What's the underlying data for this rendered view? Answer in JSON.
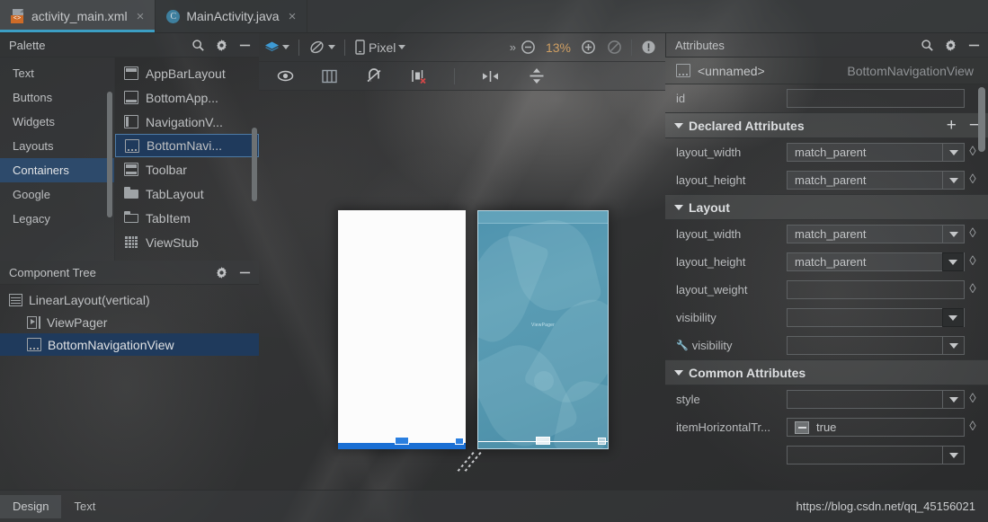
{
  "tabs": [
    {
      "label": "activity_main.xml",
      "icon": "xml-file-icon",
      "active": true,
      "close": "×"
    },
    {
      "label": "MainActivity.java",
      "icon": "java-class-icon",
      "active": false,
      "close": "×"
    }
  ],
  "palette": {
    "title": "Palette",
    "icons": {
      "search": "search-icon",
      "gear": "gear-icon",
      "minimize": "minimize-icon"
    },
    "categories": [
      {
        "label": "Text",
        "selected": false
      },
      {
        "label": "Buttons",
        "selected": false
      },
      {
        "label": "Widgets",
        "selected": false
      },
      {
        "label": "Layouts",
        "selected": false
      },
      {
        "label": "Containers",
        "selected": true
      },
      {
        "label": "Google",
        "selected": false
      },
      {
        "label": "Legacy",
        "selected": false
      }
    ],
    "items": [
      {
        "label": "AppBarLayout",
        "icon": "appbar-icon",
        "selected": false
      },
      {
        "label": "BottomApp...",
        "icon": "bottomappbar-icon",
        "selected": false
      },
      {
        "label": "NavigationV...",
        "icon": "navigationview-icon",
        "selected": false
      },
      {
        "label": "BottomNavi...",
        "icon": "bottomnavigation-icon",
        "selected": true
      },
      {
        "label": "Toolbar",
        "icon": "toolbar-icon",
        "selected": false
      },
      {
        "label": "TabLayout",
        "icon": "tablayout-icon",
        "selected": false
      },
      {
        "label": "TabItem",
        "icon": "tabitem-icon",
        "selected": false
      },
      {
        "label": "ViewStub",
        "icon": "viewstub-icon",
        "selected": false
      }
    ]
  },
  "component_tree": {
    "title": "Component Tree",
    "icons": {
      "gear": "gear-icon",
      "minimize": "minimize-icon"
    },
    "nodes": [
      {
        "label": "LinearLayout(vertical)",
        "depth": 0,
        "icon": "linearlayout-icon",
        "selected": false
      },
      {
        "label": "ViewPager",
        "depth": 1,
        "icon": "viewpager-icon",
        "selected": false
      },
      {
        "label": "BottomNavigationView",
        "depth": 1,
        "icon": "bottomnavigation-icon",
        "selected": true
      }
    ]
  },
  "editor": {
    "toolbar": {
      "design_mode_icon": "layers-icon",
      "orientation_icon": "rotate-icon",
      "device_icon": "phone-icon",
      "device_name": "Pixel",
      "overflow": "»",
      "zoom_out_icon": "zoom-out-icon",
      "zoom_level": "13%",
      "zoom_in_icon": "zoom-in-icon",
      "zoom_fit_icon": "zoom-fit-icon",
      "warnings_icon": "warning-icon"
    },
    "toolbar2": {
      "buttons": [
        {
          "name": "show-constraints-icon",
          "label": "eye"
        },
        {
          "name": "guidelines-icon",
          "label": "columns"
        },
        {
          "name": "autoconnect-off-icon",
          "label": "magnet-off"
        },
        {
          "name": "clear-constraints-icon",
          "label": "clear"
        },
        {
          "name": "align-horizontal-icon",
          "label": "pack-horizontal"
        },
        {
          "name": "align-vertical-icon",
          "label": "pack-vertical"
        }
      ]
    },
    "blueprint_label": "ViewPager"
  },
  "attributes": {
    "title": "Attributes",
    "icons": {
      "search": "search-icon",
      "gear": "gear-icon",
      "minimize": "minimize-icon"
    },
    "selected_name": "<unnamed>",
    "selected_class": "BottomNavigationView",
    "id_label": "id",
    "id_value": "",
    "sections": [
      {
        "type": "section",
        "label": "Declared Attributes",
        "has_add": true,
        "add": "+",
        "remove": "−"
      },
      {
        "type": "field",
        "label": "layout_width",
        "value": "match_parent",
        "control": "dropdown",
        "filled": true,
        "link": true,
        "focus": false
      },
      {
        "type": "field",
        "label": "layout_height",
        "value": "match_parent",
        "control": "dropdown",
        "filled": true,
        "link": true,
        "focus": false
      },
      {
        "type": "section",
        "label": "Layout",
        "has_add": false
      },
      {
        "type": "field",
        "label": "layout_width",
        "value": "match_parent",
        "control": "dropdown",
        "filled": true,
        "link": true,
        "focus": false
      },
      {
        "type": "field",
        "label": "layout_height",
        "value": "match_parent",
        "control": "dropdown",
        "filled": true,
        "link": true,
        "focus": true
      },
      {
        "type": "field",
        "label": "layout_weight",
        "value": "",
        "control": "text",
        "filled": false,
        "link": true,
        "focus": false
      },
      {
        "type": "field",
        "label": "visibility",
        "value": "",
        "control": "dropdown",
        "filled": false,
        "link": false,
        "focus": true
      },
      {
        "type": "field",
        "label": "visibility",
        "value": "",
        "control": "dropdown",
        "filled": false,
        "link": false,
        "focus": false,
        "wrench": true
      },
      {
        "type": "section",
        "label": "Common Attributes",
        "has_add": false
      },
      {
        "type": "field",
        "label": "style",
        "value": "",
        "control": "dropdown",
        "filled": false,
        "link": true,
        "focus": false
      },
      {
        "type": "field",
        "label": "itemHorizontalTr...",
        "value": "true",
        "control": "checkbox",
        "filled": false,
        "link": true,
        "focus": false
      }
    ]
  },
  "status": {
    "buttons": [
      {
        "label": "Design",
        "active": true
      },
      {
        "label": "Text",
        "active": false
      }
    ],
    "watermark": "https://blog.csdn.net/qq_45156021"
  },
  "colors": {
    "accent_blue": "#3c9ec4",
    "selection_blue": "#1f3a5c",
    "zoom_orange": "#cf9f63",
    "bnv_blue": "#1a6fd4",
    "blueprint": "#5396ae",
    "xml_badge": "#cd6b28"
  }
}
